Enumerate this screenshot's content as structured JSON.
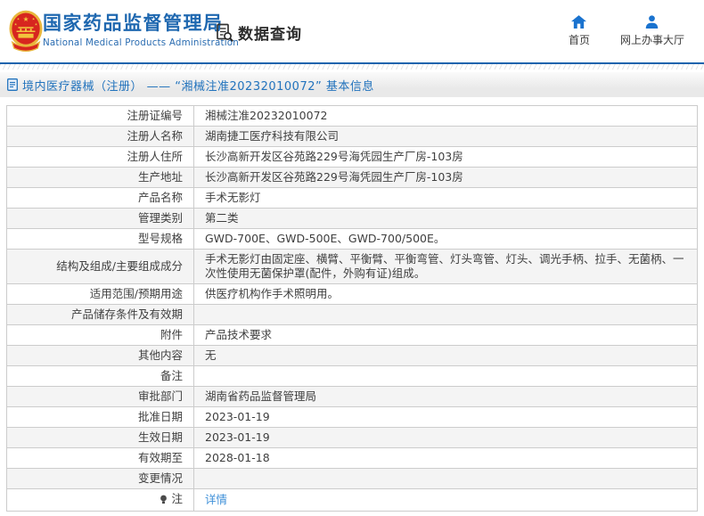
{
  "header": {
    "logo": "china-national-emblem",
    "org_name_cn": "国家药品监督管理局",
    "org_name_en": "National Medical Products Administration",
    "section": {
      "icon": "document-search-icon",
      "label": "数据查询"
    },
    "nav": [
      {
        "icon": "home-icon",
        "label": "首页"
      },
      {
        "icon": "person-icon",
        "label": "网上办事大厅"
      }
    ]
  },
  "breadcrumb": {
    "icon": "document-icon",
    "text": "境内医疗器械（注册） —— “湘械注准20232010072” 基本信息"
  },
  "table": {
    "rows": [
      {
        "label": "注册证编号",
        "value": "湘械注准20232010072"
      },
      {
        "label": "注册人名称",
        "value": "湖南捷工医疗科技有限公司"
      },
      {
        "label": "注册人住所",
        "value": "长沙高新开发区谷苑路229号海凭园生产厂房-103房"
      },
      {
        "label": "生产地址",
        "value": "长沙高新开发区谷苑路229号海凭园生产厂房-103房"
      },
      {
        "label": "产品名称",
        "value": "手术无影灯"
      },
      {
        "label": "管理类别",
        "value": "第二类"
      },
      {
        "label": "型号规格",
        "value": "GWD-700E、GWD-500E、GWD-700/500E。"
      },
      {
        "label": "结构及组成/主要组成成分",
        "value": "手术无影灯由固定座、横臂、平衡臂、平衡弯管、灯头弯管、灯头、调光手柄、拉手、无菌柄、一次性使用无菌保护罩(配件，外购有证)组成。"
      },
      {
        "label": "适用范围/预期用途",
        "value": "供医疗机构作手术照明用。"
      },
      {
        "label": "产品储存条件及有效期",
        "value": ""
      },
      {
        "label": "附件",
        "value": "产品技术要求"
      },
      {
        "label": "其他内容",
        "value": "无"
      },
      {
        "label": "备注",
        "value": ""
      },
      {
        "label": "审批部门",
        "value": "湖南省药品监督管理局"
      },
      {
        "label": "批准日期",
        "value": "2023-01-19"
      },
      {
        "label": "生效日期",
        "value": "2023-01-19"
      },
      {
        "label": "有效期至",
        "value": "2028-01-18"
      },
      {
        "label": "变更情况",
        "value": ""
      },
      {
        "label": "注",
        "value": "详情",
        "label_icon": "bulb-icon",
        "value_is_link": true
      }
    ]
  },
  "colors": {
    "brand_blue": "#1f68b0",
    "header_rule_blue": "#1c64ad",
    "nav_icon_blue": "#1a73cf",
    "breadcrumb_blue": "#2273bd",
    "link_blue": "#3d8fd8",
    "alt_row_bg": "#f4f4f4",
    "table_border": "#cccccc"
  }
}
